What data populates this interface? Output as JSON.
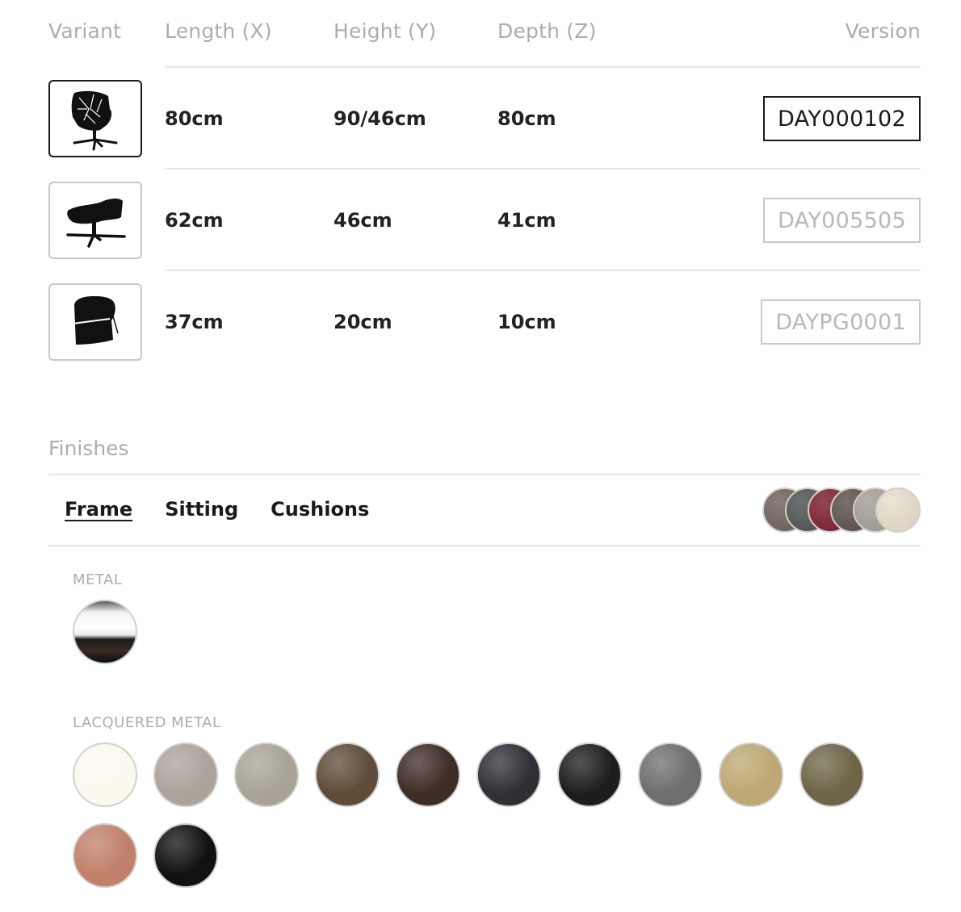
{
  "table": {
    "headers": {
      "variant": "Variant",
      "length": "Length (X)",
      "height": "Height (Y)",
      "depth": "Depth (Z)",
      "version": "Version"
    },
    "rows": [
      {
        "icon": "lounge-chair-icon",
        "length": "80cm",
        "height": "90/46cm",
        "depth": "80cm",
        "version": "DAY000102",
        "selected": true
      },
      {
        "icon": "footstool-icon",
        "length": "62cm",
        "height": "46cm",
        "depth": "41cm",
        "version": "DAY005505",
        "selected": false
      },
      {
        "icon": "headrest-cushion-icon",
        "length": "37cm",
        "height": "20cm",
        "depth": "10cm",
        "version": "DAYPG0001",
        "selected": false
      }
    ]
  },
  "finishes": {
    "title": "Finishes",
    "tabs": [
      {
        "label": "Frame",
        "active": true
      },
      {
        "label": "Sitting",
        "active": false
      },
      {
        "label": "Cushions",
        "active": false
      }
    ],
    "stack_colors": [
      "#6e6259",
      "#4f5252",
      "#7a1e2c",
      "#5d5149",
      "#a59e97",
      "#e8dfc9"
    ],
    "groups": {
      "metal": {
        "label": "METAL",
        "swatches": [
          {
            "name": "chrome",
            "color": "#d9d9d9"
          }
        ]
      },
      "lacquered": {
        "label": "LACQUERED METAL",
        "swatches": [
          {
            "name": "cream",
            "color": "#fbf9ee"
          },
          {
            "name": "taupe-grey",
            "color": "#aca39b"
          },
          {
            "name": "sand",
            "color": "#a8a396"
          },
          {
            "name": "bronze-brown",
            "color": "#5e4c39"
          },
          {
            "name": "dark-brown",
            "color": "#3e2c26"
          },
          {
            "name": "anthracite",
            "color": "#2f3036"
          },
          {
            "name": "black",
            "color": "#1d1d1d"
          },
          {
            "name": "grey",
            "color": "#6e6e6e"
          },
          {
            "name": "gold",
            "color": "#bda873"
          },
          {
            "name": "olive-bronze",
            "color": "#6e6547"
          },
          {
            "name": "copper",
            "color": "#c0806a"
          },
          {
            "name": "glossy-black",
            "color": "#111111"
          }
        ]
      }
    }
  }
}
